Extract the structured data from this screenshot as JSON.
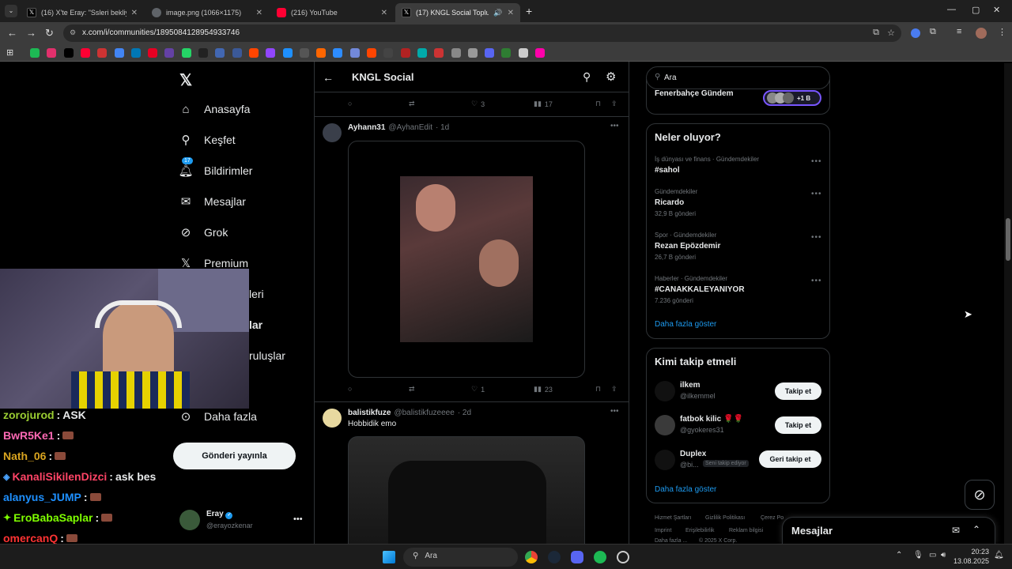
{
  "browser": {
    "tabs": [
      {
        "title": "(16) X'te Eray: \"Ssleri bekliyorum\"",
        "color": "#000000"
      },
      {
        "title": "image.png (1066×1175)",
        "color": "#5f6368"
      },
      {
        "title": "(216) YouTube",
        "color": "#ff0033"
      },
      {
        "title": "(17) KNGL Social Topluluk /",
        "color": "#000000"
      }
    ],
    "url": "x.com/i/communities/1895084128954933746"
  },
  "nav": {
    "items": [
      {
        "label": "Anasayfa",
        "icon": "home-icon"
      },
      {
        "label": "Keşfet",
        "icon": "search-icon"
      },
      {
        "label": "Bildirimler",
        "icon": "bell-icon",
        "badge": "17"
      },
      {
        "label": "Mesajlar",
        "icon": "mail-icon"
      },
      {
        "label": "Grok",
        "icon": "grok-icon"
      },
      {
        "label": "Premium",
        "icon": "x-icon"
      }
    ],
    "partial_items": [
      "leri",
      "lar",
      "ruluşlar"
    ],
    "more_label": "Daha fazla",
    "post_label": "Gönderi yayınla",
    "account_name": "Eray",
    "account_handle": "@erayozkenar"
  },
  "header": {
    "title": "KNGL Social"
  },
  "posts": [
    {
      "stats": {
        "replies": "",
        "reposts": "",
        "likes": "3",
        "views": "17"
      }
    },
    {
      "name": "Ayhann31",
      "handle": "@AyhanEdit",
      "time": "· 1d",
      "stats": {
        "replies": "",
        "reposts": "",
        "likes": "1",
        "views": "23"
      }
    },
    {
      "name": "balistikfuze",
      "handle": "@balistikfuzeeee",
      "time": "· 2d",
      "text": "Hobbidik emo"
    }
  ],
  "search": {
    "placeholder": "Ara"
  },
  "community_card": {
    "title": "Fenerbahçe Gündem",
    "members_badge": "+1 B"
  },
  "trends": {
    "title": "Neler oluyor?",
    "items": [
      {
        "meta": "İş dünyası ve finans · Gündemdekiler",
        "title": "#sahol",
        "count": ""
      },
      {
        "meta": "Gündemdekiler",
        "title": "Ricardo",
        "count": "32,9 B gönderi"
      },
      {
        "meta": "Spor · Gündemdekiler",
        "title": "Rezan Epözdemir",
        "count": "26,7 B gönderi"
      },
      {
        "meta": "Haberler · Gündemdekiler",
        "title": "#CANAKKALEYANIYOR",
        "count": "7.236 gönderi"
      }
    ],
    "more": "Daha fazla göster"
  },
  "who_to_follow": {
    "title": "Kimi takip etmeli",
    "items": [
      {
        "name": "ilkem",
        "handle": "@ilkemmel",
        "button": "Takip et"
      },
      {
        "name": "fatbok kilic 🌹🌹",
        "handle": "@gyokeres31",
        "button": "Takip et"
      },
      {
        "name": "Duplex",
        "handle": "@bi...",
        "tag": "Seni takip ediyor",
        "button": "Geri takip et"
      }
    ],
    "more": "Daha fazla göster"
  },
  "footer_links": [
    "Hizmet Şartları",
    "Gizlilik Politikası",
    "Çerez Po",
    "Imprint",
    "Erişilebilirlik",
    "Reklam bilgisi",
    "Daha fazla ...",
    "© 2025 X Corp."
  ],
  "messages_dock": {
    "title": "Mesajlar"
  },
  "chat": [
    {
      "user": "zorojurod",
      "color": "#9acd32",
      "msg": "ASK"
    },
    {
      "user": "BwR5Ke1",
      "color": "#ff69b4",
      "msg": ""
    },
    {
      "user": "Nath_06",
      "color": "#daa520",
      "msg": ""
    },
    {
      "user": "KanaliSikilenDizci",
      "color": "#ff4466",
      "msg": "ask bes"
    },
    {
      "user": "alanyus_JUMP",
      "color": "#1e90ff",
      "msg": ""
    },
    {
      "user": "EroBabaSaplar",
      "color": "#7fff00",
      "msg": ""
    },
    {
      "user": "omercanQ",
      "color": "#ff3333",
      "msg": ""
    }
  ],
  "taskbar": {
    "search": "Ara",
    "time": "20:23",
    "date": "13.08.2025"
  },
  "colors": {
    "accent": "#1d9bf0",
    "bg": "#000000",
    "border": "#2f3336",
    "muted": "#71767b"
  }
}
